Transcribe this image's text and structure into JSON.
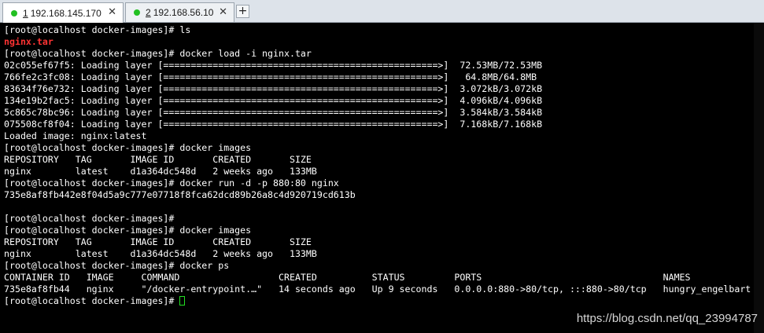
{
  "tabs": [
    {
      "number": "1",
      "host": "192.168.145.170",
      "status_color": "#22c022"
    },
    {
      "number": "2",
      "host": "192.168.56.10",
      "status_color": "#22c022"
    }
  ],
  "tab_close_glyph": "✕",
  "new_tab_glyph": "+",
  "terminal": {
    "lines": [
      {
        "text": "[root@localhost docker-images]# ls",
        "style": "normal"
      },
      {
        "text": "nginx.tar",
        "style": "red"
      },
      {
        "text": "[root@localhost docker-images]# docker load -i nginx.tar",
        "style": "normal"
      },
      {
        "text": "02c055ef67f5: Loading layer [==================================================>]  72.53MB/72.53MB",
        "style": "normal"
      },
      {
        "text": "766fe2c3fc08: Loading layer [==================================================>]   64.8MB/64.8MB",
        "style": "normal"
      },
      {
        "text": "83634f76e732: Loading layer [==================================================>]  3.072kB/3.072kB",
        "style": "normal"
      },
      {
        "text": "134e19b2fac5: Loading layer [==================================================>]  4.096kB/4.096kB",
        "style": "normal"
      },
      {
        "text": "5c865c78bc96: Loading layer [==================================================>]  3.584kB/3.584kB",
        "style": "normal"
      },
      {
        "text": "075508cf8f04: Loading layer [==================================================>]  7.168kB/7.168kB",
        "style": "normal"
      },
      {
        "text": "Loaded image: nginx:latest",
        "style": "normal"
      },
      {
        "text": "[root@localhost docker-images]# docker images",
        "style": "normal"
      },
      {
        "text": "REPOSITORY   TAG       IMAGE ID       CREATED       SIZE",
        "style": "normal"
      },
      {
        "text": "nginx        latest    d1a364dc548d   2 weeks ago   133MB",
        "style": "normal"
      },
      {
        "text": "[root@localhost docker-images]# docker run -d -p 880:80 nginx",
        "style": "normal"
      },
      {
        "text": "735e8af8fb442e8f04d5a9c777e07718f8fca62dcd89b26a8c4d920719cd613b",
        "style": "normal"
      },
      {
        "text": "",
        "style": "normal"
      },
      {
        "text": "[root@localhost docker-images]#",
        "style": "normal"
      },
      {
        "text": "[root@localhost docker-images]# docker images",
        "style": "normal"
      },
      {
        "text": "REPOSITORY   TAG       IMAGE ID       CREATED       SIZE",
        "style": "normal"
      },
      {
        "text": "nginx        latest    d1a364dc548d   2 weeks ago   133MB",
        "style": "normal"
      },
      {
        "text": "[root@localhost docker-images]# docker ps",
        "style": "normal"
      },
      {
        "text": "CONTAINER ID   IMAGE     COMMAND                  CREATED          STATUS         PORTS                                 NAMES",
        "style": "normal"
      },
      {
        "text": "735e8af8fb44   nginx     \"/docker-entrypoint.…\"   14 seconds ago   Up 9 seconds   0.0.0.0:880->80/tcp, :::880->80/tcp   hungry_engelbart",
        "style": "normal"
      }
    ],
    "prompt": "[root@localhost docker-images]# ",
    "cursor_color": "#22e022",
    "background": "#000000",
    "foreground": "#ffffff",
    "highlight_color": "#ff3333"
  },
  "watermark": "https://blog.csdn.net/qq_23994787"
}
